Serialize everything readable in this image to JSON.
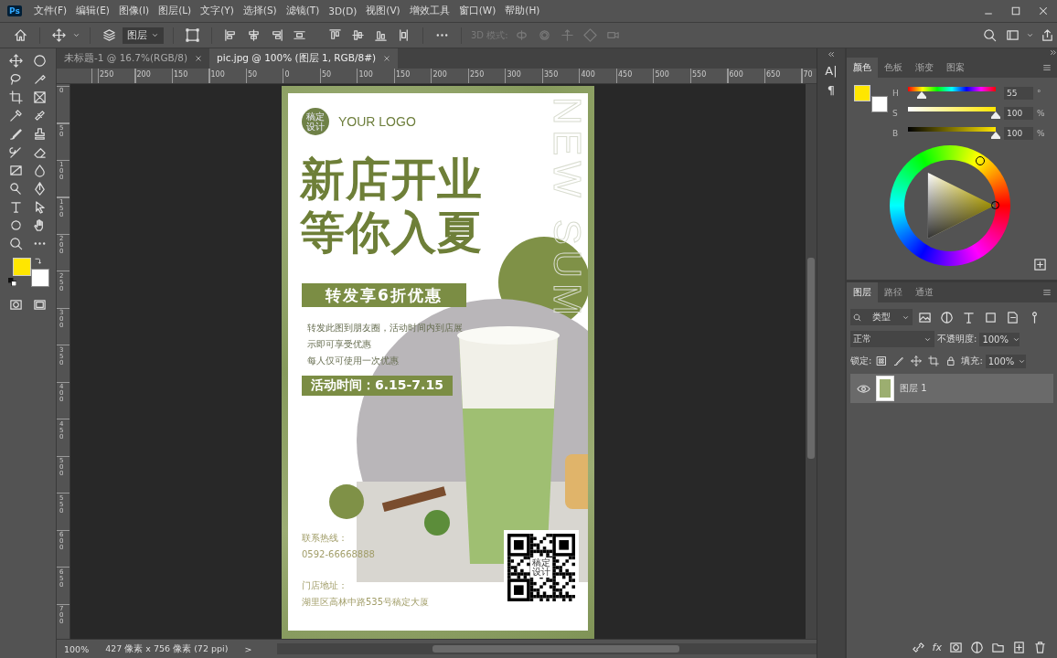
{
  "menu_bar": {
    "app_icon": "Ps",
    "items": [
      "文件(F)",
      "编辑(E)",
      "图像(I)",
      "图层(L)",
      "文字(Y)",
      "选择(S)",
      "滤镜(T)",
      "3D(D)",
      "视图(V)",
      "增效工具",
      "窗口(W)",
      "帮助(H)"
    ]
  },
  "options_bar": {
    "select_target": "图层",
    "mode_label": "3D 模式:"
  },
  "document_tabs": [
    {
      "label": "未标题-1 @ 16.7%(RGB/8)",
      "selected": false
    },
    {
      "label": "pic.jpg @ 100% (图层 1, RGB/8#)",
      "selected": true
    }
  ],
  "rulers": {
    "horizontal": [
      "250",
      "200",
      "150",
      "100",
      "50",
      "0",
      "50",
      "100",
      "150",
      "200",
      "250",
      "300",
      "350",
      "400",
      "450",
      "500",
      "550",
      "600",
      "650",
      "70"
    ],
    "vertical": [
      "0",
      "50",
      "100",
      "150",
      "200",
      "250",
      "300",
      "350",
      "400",
      "450",
      "500",
      "550",
      "600",
      "650",
      "700"
    ]
  },
  "poster": {
    "logo_mark": "稿定设计",
    "logo_text": "YOUR LOGO",
    "watermark": "NEW SUM",
    "title_lines": [
      "新店开业",
      "等你入夏"
    ],
    "offer_banner": "转发享6折优惠",
    "offer_lines": [
      "转发此图到朋友圈，活动时间内到店展",
      "示即可享受优惠",
      "每人仅可使用一次优惠"
    ],
    "date_banner": "活动时间：6.15-7.15",
    "hotline_label": "联系热线：",
    "hotline": "0592-66668888",
    "address_label": "门店地址：",
    "address": "湖里区高林中路535号稿定大厦",
    "qr_mark": "稿定设计"
  },
  "status_bar": {
    "zoom": "100%",
    "dimensions": "427 像素 x 756 像素 (72 ppi)",
    "arrow": ">"
  },
  "side_strip": {
    "character_button": "A|",
    "paragraph_button": "¶"
  },
  "color_panel": {
    "tabs": [
      {
        "label": "颜色",
        "selected": true
      },
      {
        "label": "色板",
        "selected": false
      },
      {
        "label": "渐变",
        "selected": false
      },
      {
        "label": "图案",
        "selected": false
      }
    ],
    "channels": [
      {
        "kind": "hue",
        "label": "H",
        "value": "55",
        "unit": "°",
        "level": 0.153
      },
      {
        "kind": "saturation",
        "label": "S",
        "value": "100",
        "unit": "%",
        "level": 1
      },
      {
        "kind": "brightness",
        "label": "B",
        "value": "100",
        "unit": "%",
        "level": 1
      }
    ]
  },
  "layers_panel": {
    "tabs": [
      {
        "label": "图层",
        "selected": true
      },
      {
        "label": "路径",
        "selected": false
      },
      {
        "label": "通道",
        "selected": false
      }
    ],
    "filter": "类型",
    "blend_mode": "正常",
    "opacity_label": "不透明度:",
    "opacity": "100%",
    "lock_label": "锁定:",
    "fill_label": "填充:",
    "fill": "100%",
    "layers": [
      {
        "name": "图层 1",
        "visible": true,
        "selected": true
      }
    ],
    "fx_button": "fx"
  }
}
